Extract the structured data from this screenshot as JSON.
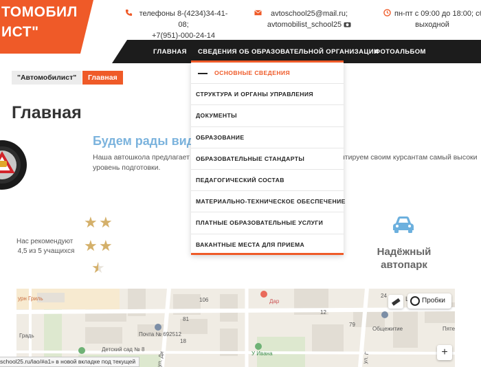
{
  "logo": {
    "line1": "ТОМОБИЛ",
    "line2": "ИСТ\""
  },
  "header": {
    "phone": {
      "line1": "телефоны 8-(4234)34-41-08;",
      "line2": "+7(951)-000-24-14"
    },
    "mail": {
      "line1": "avtoschool25@mail.ru;",
      "line2": "avtomobilist_school25"
    },
    "hours": {
      "line1": "пн-пт с 09:00 до 18:00; сб",
      "line2": "выходной"
    }
  },
  "nav": {
    "items": [
      "ГЛАВНАЯ",
      "СВЕДЕНИЯ ОБ ОБРАЗОВАТЕЛЬНОЙ ОРГАНИЗАЦИИ",
      "ФОТОАЛЬБОМ"
    ]
  },
  "dropdown": {
    "items": [
      "ОСНОВНЫЕ СВЕДЕНИЯ",
      "СТРУКТУРА И ОРГАНЫ УПРАВЛЕНИЯ",
      "ДОКУМЕНТЫ",
      "ОБРАЗОВАНИЕ",
      "ОБРАЗОВАТЕЛЬНЫЕ СТАНДАРТЫ",
      "ПЕДАГОГИЧЕСКИЙ СОСТАВ",
      "МАТЕРИАЛЬНО-ТЕХНИЧЕСКОЕ ОБЕСПЕЧЕНИЕ",
      "ПЛАТНЫЕ ОБРАЗОВАТЕЛЬНЫЕ УСЛУГИ",
      "ВАКАНТНЫЕ МЕСТА ДЛЯ ПРИЕМА"
    ]
  },
  "breadcrumb": {
    "parent": "\"Автомобилист\"",
    "current": "Главная"
  },
  "page": {
    "title": "Главная",
    "welcome": "Будем рады вид",
    "intro_line1": "Наша автошкола предлагает с",
    "intro_line2": "уровень подготовки.",
    "intro_right": "нтируем своим курсантам самый высоки"
  },
  "rating": {
    "line1": "Нас рекомендуют",
    "line2": "4,5 из 5 учащихся"
  },
  "feature": {
    "label": "Надёжный автопарк"
  },
  "map": {
    "labels": [
      "урн Гриль",
      "Градь",
      "Детский сад № 8",
      "Почта № 692512",
      "106",
      "81",
      "Дар",
      "12",
      "79",
      "У Ивана",
      "Общежитие",
      "Пятер",
      "18",
      "24",
      "ул. Ди",
      "ул. Г",
      "Ц"
    ],
    "traffic_button": "Пробки"
  },
  "statusbar": {
    "text": "school25.ru/lao/#a1» в новой вкладке под текущей"
  },
  "colors": {
    "accent": "#ef5a28",
    "nav_bg": "#1c1c1c",
    "welcome": "#7bb3dd"
  }
}
